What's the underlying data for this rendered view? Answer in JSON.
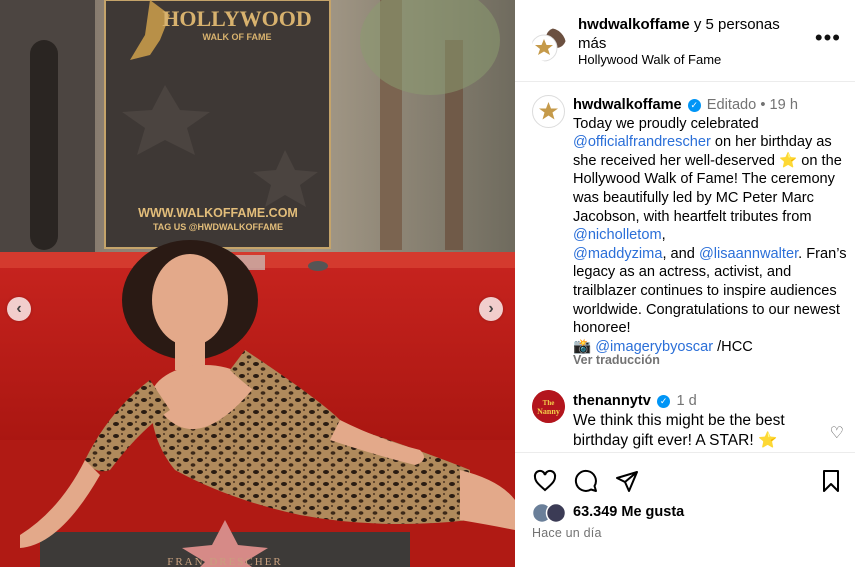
{
  "photo": {
    "backdrop_brand": "HOLLYWOOD",
    "backdrop_sub": "WALK OF FAME",
    "backdrop_url": "WWW.WALKOFFAME.COM",
    "backdrop_tag": "TAG US @HWDWALKOFFAME",
    "star_name": "FRAN DRESCHER",
    "prev_icon": "chevron-left-icon",
    "next_icon": "chevron-right-icon"
  },
  "header": {
    "account": "hwdwalkoffame",
    "collab_suffix": " y 5 personas más",
    "location": "Hollywood Walk of Fame",
    "more_icon": "more-options-icon"
  },
  "caption": {
    "username": "hwdwalkoffame",
    "edited": "Editado",
    "dot": "•",
    "time": "19 h",
    "t1": "Today we proudly celebrated ",
    "m1": "@officialfrandrescher",
    "t2": " on her birthday as she received her well-deserved ",
    "star_emoji": "⭐",
    "t3": " on the Hollywood Walk of Fame! The ceremony was beautifully led by MC Peter Marc Jacobson, with heartfelt tributes from ",
    "m2": "@nicholletom",
    "t4": ", ",
    "m3": "@maddyzima",
    "t5": ", and ",
    "m4": "@lisaannwalter",
    "t6": ". Fran’s legacy as an actress, activist, and trailblazer continues to inspire audiences worldwide. Congratulations to our newest honoree!",
    "camera_emoji": "📸",
    "m5": "@imagerybyoscar",
    "t7": " /HCC",
    "translate": "Ver traducción"
  },
  "reply": {
    "username": "thenannytv",
    "time": "1 d",
    "text": "We think this might be the best birthday gift ever! A STAR! ",
    "star_emoji": "⭐",
    "avatar_text": "The Nanny"
  },
  "actions": {
    "like_icon": "heart-icon",
    "comment_icon": "comment-icon",
    "share_icon": "share-icon",
    "save_icon": "bookmark-icon",
    "likes": "63.349 Me gusta",
    "posted": "Hace un día"
  },
  "colors": {
    "link": "#00376b",
    "verified": "#0095f6",
    "muted": "#737373",
    "carpet": "#c0201e"
  }
}
